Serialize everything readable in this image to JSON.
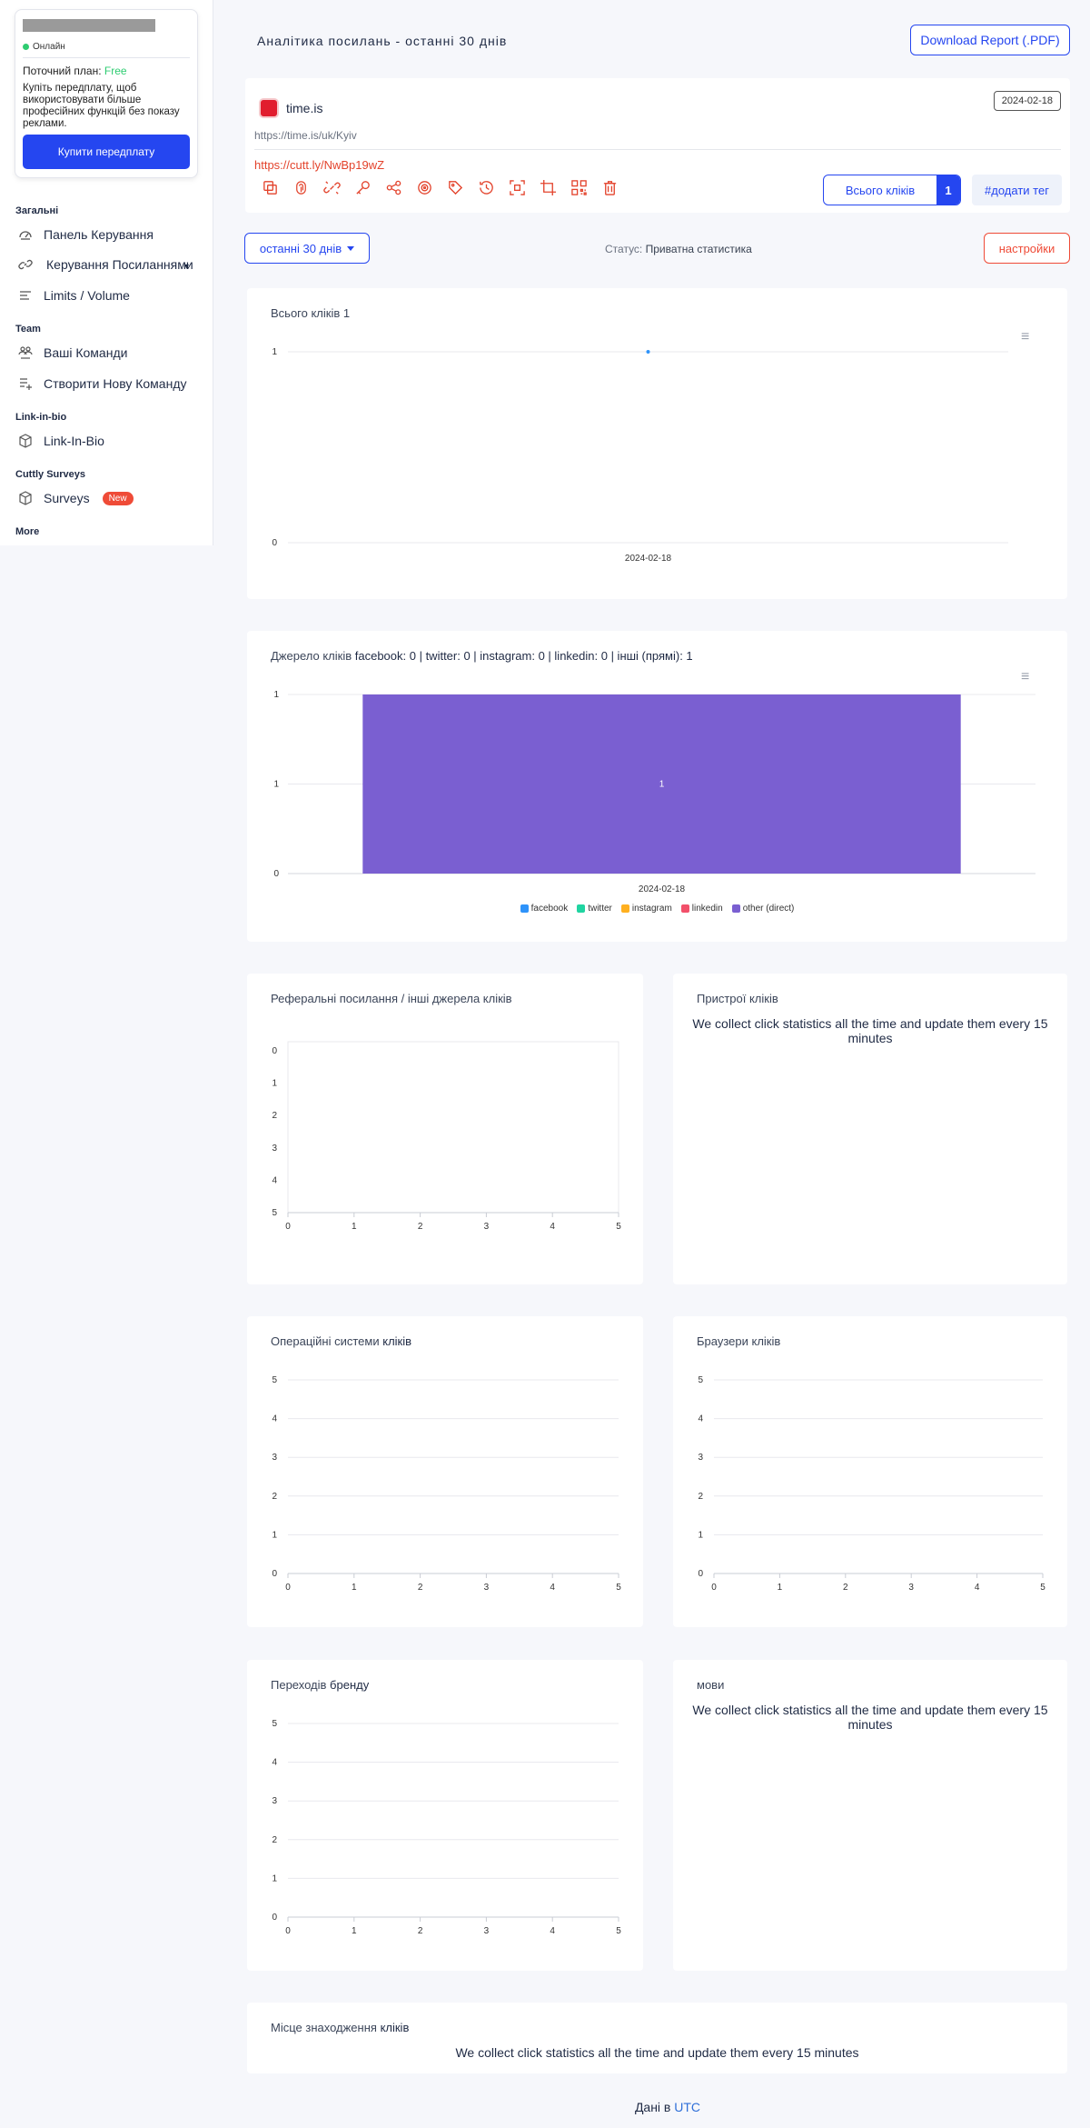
{
  "sidebar": {
    "status": "Онлайн",
    "plan_label": "Поточний план:",
    "plan_value": "Free",
    "promo": "Купіть передплату, щоб використовувати більше професійних функцій без показу реклами.",
    "buy_button": "Купити передплату",
    "sections": {
      "general": "Загальні",
      "team": "Team",
      "linkinbio": "Link-in-bio",
      "surveys": "Cuttly Surveys",
      "more": "More"
    },
    "items": {
      "dashboard": "Панель Керування",
      "links": "Керування Посиланнями",
      "limits": "Limits / Volume",
      "teams": "Ваші Команди",
      "new_team": "Створити Нову Команду",
      "linkinbio": "Link-In-Bio",
      "surveys": "Surveys",
      "new_badge": "New"
    }
  },
  "header": {
    "title": "Аналітика посилань - останні 30 днів",
    "download": "Download Report (.PDF)"
  },
  "link": {
    "title": "time.is",
    "long_url": "https://time.is/uk/Kyiv",
    "short_url": "https://cutt.ly/NwBp19wZ",
    "date": "2024-02-18",
    "clicks_label": "Всього кліків",
    "clicks_count": "1",
    "add_tag": "#додати тег"
  },
  "toolbar": {
    "tools": [
      "copy-icon",
      "fingerprint-icon",
      "link-edit-icon",
      "key-icon",
      "share-icon",
      "target-icon",
      "tag-icon",
      "history-icon",
      "focus-icon",
      "crop-icon",
      "qr-code-icon",
      "trash-icon"
    ]
  },
  "filters": {
    "period": "останні 30 днів",
    "status_label": "Статус:",
    "status_value": "Приватна статистика",
    "settings": "настройки"
  },
  "panels": {
    "total_title": "Всього кліків",
    "total_value": "1",
    "sources_title": "Джерело кліків",
    "sources_summary": "facebook: 0 | twitter: 0 | instagram: 0 | linkedin: 0 | інші (прямі): 1",
    "referrals_title": "Реферальні посилання / інші джерела кліків",
    "devices_title": "Пристрої кліків",
    "os_title_a": "Операційні системи ",
    "os_title_b": "кліків",
    "browsers_title": "Браузери кліків",
    "brand_title_a": "Переходів ",
    "brand_title_b": "бренду",
    "languages_title": "мови",
    "location_title_a": "Місце знаходження ",
    "location_title_b": "кліків",
    "collect_msg": "We collect click statistics all the time and update them every 15 minutes"
  },
  "colors": {
    "accent": "#2546f0",
    "danger": "#ef4b37",
    "bar": "#7a5fd1"
  },
  "chart_data": [
    {
      "type": "line",
      "title": "Всього кліків 1",
      "x": [
        "2024-02-18"
      ],
      "series": [
        {
          "values": [
            1
          ]
        }
      ],
      "ylim": [
        0,
        1
      ],
      "yticks": [
        "0",
        "1"
      ],
      "grid": true
    },
    {
      "type": "bar",
      "title": "Джерело кліків facebook: 0 | twitter: 0 | instagram: 0 | linkedin: 0 | інші (прямі): 1",
      "categories": [
        "2024-02-18"
      ],
      "series": [
        {
          "name": "facebook",
          "values": [
            0
          ],
          "color": "#2e93fa"
        },
        {
          "name": "twitter",
          "values": [
            0
          ],
          "color": "#20d4a1"
        },
        {
          "name": "instagram",
          "values": [
            0
          ],
          "color": "#ffb020"
        },
        {
          "name": "linkedin",
          "values": [
            0
          ],
          "color": "#f2506a"
        },
        {
          "name": "other (direct)",
          "values": [
            1
          ],
          "color": "#7a5fd1"
        }
      ],
      "yticks": [
        "0",
        "1",
        "1"
      ],
      "data_labels": [
        "1"
      ],
      "legend": "bottom"
    },
    {
      "type": "bar",
      "title": "Реферальні посилання / інші джерела кліків",
      "categories": [],
      "xticks": [
        "0",
        "1",
        "2",
        "3",
        "4",
        "5"
      ],
      "yticks": [
        "0",
        "1",
        "2",
        "3",
        "4",
        "5"
      ]
    },
    {
      "type": "bar",
      "title": "Операційні системи кліків",
      "categories": [],
      "xticks": [
        "0",
        "1",
        "2",
        "3",
        "4",
        "5"
      ],
      "yticks": [
        "5",
        "4",
        "3",
        "2",
        "1",
        "0"
      ]
    },
    {
      "type": "bar",
      "title": "Браузери кліків",
      "categories": [],
      "xticks": [
        "0",
        "1",
        "2",
        "3",
        "4",
        "5"
      ],
      "yticks": [
        "5",
        "4",
        "3",
        "2",
        "1",
        "0"
      ]
    },
    {
      "type": "bar",
      "title": "Переходів бренду",
      "categories": [],
      "xticks": [
        "0",
        "1",
        "2",
        "3",
        "4",
        "5"
      ],
      "yticks": [
        "5",
        "4",
        "3",
        "2",
        "1",
        "0"
      ]
    }
  ],
  "footer": {
    "prefix": "Дані в ",
    "tz": "UTC"
  }
}
